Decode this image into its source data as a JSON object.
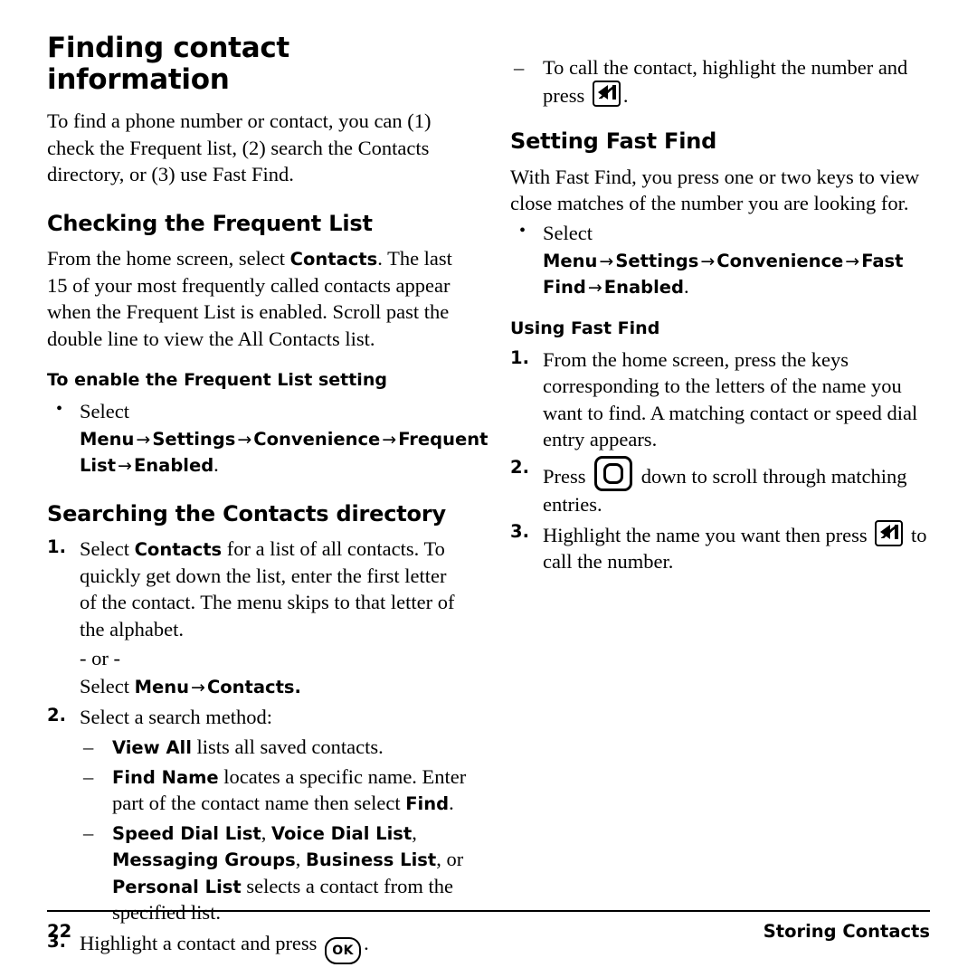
{
  "document": {
    "title": "Finding contact information",
    "footer": {
      "page_number": "22",
      "section_label": "Storing Contacts"
    }
  },
  "left_column": {
    "intro": "To find a phone number or contact, you can (1) check the Frequent list, (2) search the Contacts directory, or (3) use Fast Find.",
    "section_frequent": {
      "heading": "Checking the Frequent List",
      "paragraph": "From the home screen, select ",
      "paragraph_bold": "Contacts",
      "paragraph_rest": ". The last 15 of your most frequently called contacts appear when the Frequent List is enabled. Scroll past the double line to view the All Contacts list.",
      "subheading": "To enable the Frequent List setting",
      "bullet": {
        "lead": "Select ",
        "menu": "Menu",
        "settings": "Settings",
        "convenience": "Convenience",
        "frequent_list": "Frequent List",
        "enabled": "Enabled",
        "period": ".",
        "arrow": "→"
      }
    },
    "section_searching": {
      "heading": "Searching the Contacts directory",
      "step1": {
        "marker": "1.",
        "lead": "Select ",
        "contacts": "Contacts",
        "rest": " for a list of all contacts. To quickly get down the list, enter the first letter of the contact. The menu skips to that letter of the alphabet."
      },
      "or_label": "- or -",
      "or_line": {
        "lead": "Select ",
        "menu": "Menu",
        "arrow": "→",
        "contacts": "Contacts."
      },
      "step2": {
        "marker": "2.",
        "text": "Select a search method:"
      },
      "methods": [
        {
          "bold": "View All",
          "rest": " lists all saved contacts."
        },
        {
          "bold": "Find Name",
          "rest": " locates a specific name. Enter part of the contact name then select ",
          "bold2": "Find",
          "rest2": "."
        },
        {
          "bold": "Speed Dial List",
          "sep1": ", ",
          "bold2": "Voice Dial List",
          "sep2": ", ",
          "bold3": "Messaging Groups",
          "sep3": ", ",
          "bold4": "Business List",
          "sep4": ", or ",
          "bold5": "Personal List",
          "rest": " selects a contact from the specified list."
        }
      ],
      "step3": {
        "marker": "3.",
        "text_before": "Highlight a contact and press ",
        "key": "ok-key",
        "text_after": "."
      }
    }
  },
  "right_column": {
    "top_dash": {
      "text_before": "To call the contact, highlight the number and press ",
      "key": "send-key",
      "text_after": "."
    },
    "section_setting_fast_find": {
      "heading": "Setting Fast Find",
      "paragraph": "With Fast Find, you press one or two keys to view close matches of the number you are looking for.",
      "bullet": {
        "lead": "Select ",
        "menu": "Menu",
        "settings": "Settings",
        "convenience": "Convenience",
        "fast_find": "Fast Find",
        "enabled": "Enabled",
        "period": ".",
        "arrow": "→"
      }
    },
    "section_using_fast_find": {
      "heading": "Using Fast Find",
      "steps": [
        {
          "marker": "1.",
          "text": "From the home screen, press the keys corresponding to the letters of the name you want to find. A matching contact or speed dial entry appears."
        },
        {
          "marker": "2.",
          "text_before": "Press ",
          "key": "nav-key",
          "text_after": " down to scroll through matching entries."
        },
        {
          "marker": "3.",
          "text_before": "Highlight the name you want then press ",
          "key": "send-key",
          "text_after": " to call the number."
        }
      ]
    }
  }
}
